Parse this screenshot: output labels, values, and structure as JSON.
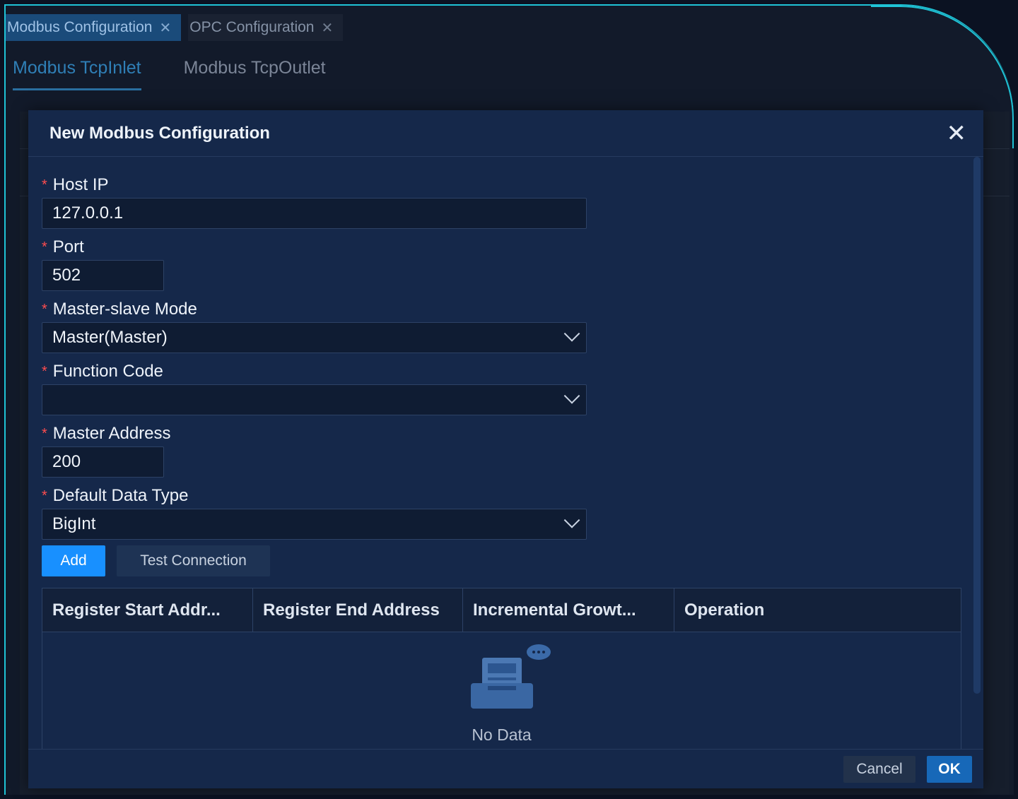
{
  "page_tabs": [
    {
      "label": "Modbus Configuration",
      "active": true
    },
    {
      "label": "OPC Configuration",
      "active": false
    }
  ],
  "sub_tabs": [
    {
      "label": "Modbus TcpInlet",
      "active": true
    },
    {
      "label": "Modbus TcpOutlet",
      "active": false
    }
  ],
  "modal": {
    "title": "New Modbus Configuration",
    "fields": {
      "host_ip": {
        "label": "Host IP",
        "value": "127.0.0.1"
      },
      "port": {
        "label": "Port",
        "value": "502"
      },
      "mode": {
        "label": "Master-slave Mode",
        "value": "Master(Master)"
      },
      "function_code": {
        "label": "Function Code",
        "value": ""
      },
      "master_address": {
        "label": "Master Address",
        "value": "200"
      },
      "data_type": {
        "label": "Default Data Type",
        "value": "BigInt"
      }
    },
    "buttons": {
      "add": "Add",
      "test": "Test Connection"
    },
    "table": {
      "columns": [
        "Register Start Addr...",
        "Register End Address",
        "Incremental Growt...",
        "Operation"
      ],
      "empty_text": "No Data"
    },
    "footer": {
      "cancel": "Cancel",
      "ok": "OK"
    }
  },
  "icons": {
    "close": "close-icon",
    "tab_close": "x-icon",
    "chevron": "chevron-down-icon",
    "empty": "empty-box-icon"
  },
  "colors": {
    "accent": "#1890ff",
    "required": "#ff4d4f",
    "frame": "#1fc3d6"
  }
}
